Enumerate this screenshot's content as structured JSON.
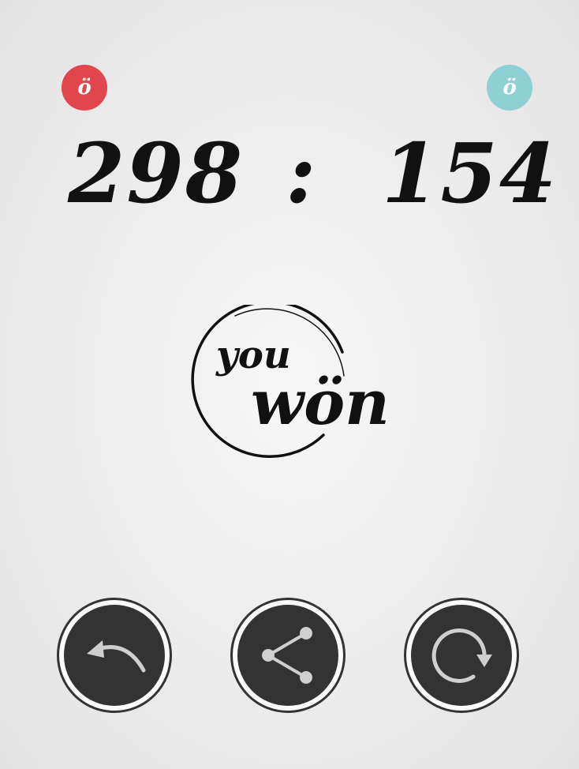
{
  "players": {
    "left": {
      "badge_letter": "ö",
      "color": "#e0464b"
    },
    "right": {
      "badge_letter": "ö",
      "color": "#8fd0d4"
    }
  },
  "score": {
    "left": "298",
    "separator": ":",
    "right": "154"
  },
  "result": {
    "line1": "you",
    "line2": "wön"
  },
  "actions": [
    {
      "name": "back",
      "icon": "back-arrow-icon"
    },
    {
      "name": "share",
      "icon": "share-icon"
    },
    {
      "name": "replay",
      "icon": "replay-icon"
    }
  ]
}
